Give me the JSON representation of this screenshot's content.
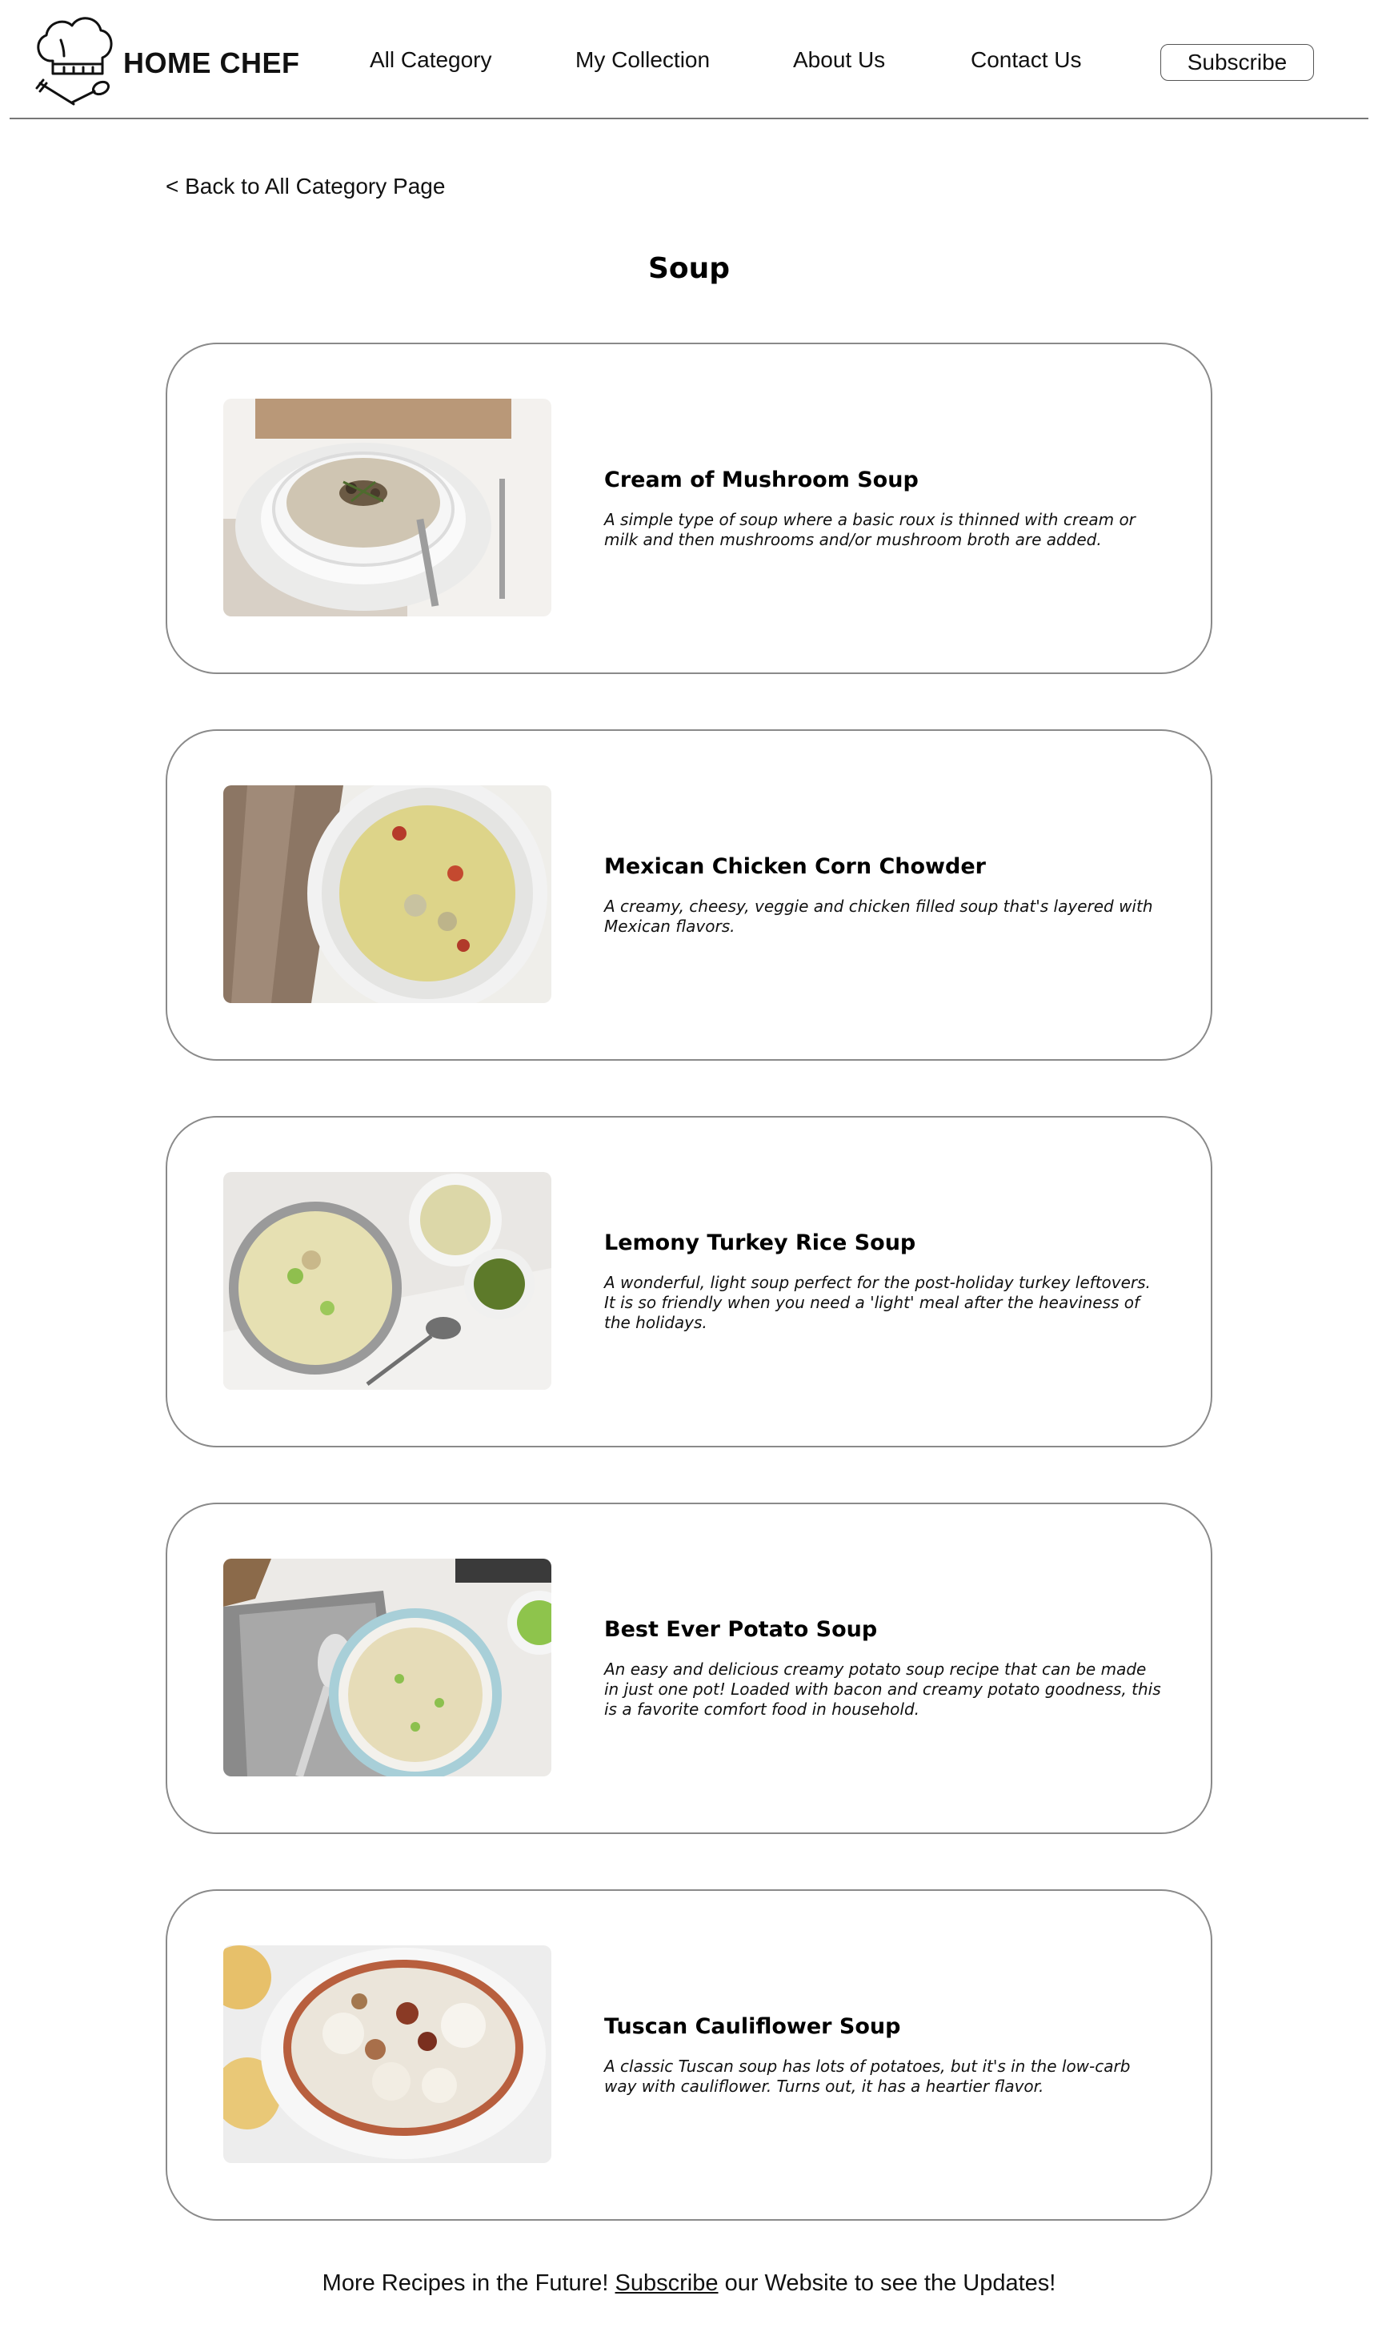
{
  "brand": {
    "name": "HOME CHEF",
    "logo_icon": "chef-hat-utensils-icon"
  },
  "nav": {
    "items": [
      {
        "label": "All Category"
      },
      {
        "label": "My Collection"
      },
      {
        "label": "About Us"
      },
      {
        "label": "Contact Us"
      }
    ],
    "subscribe_label": "Subscribe"
  },
  "back_link": "< Back to All Category Page",
  "page_title": "Soup",
  "recipes": [
    {
      "title": "Cream of Mushroom Soup",
      "description": "A simple type of soup where a basic roux is thinned with cream or milk and then mushrooms and/or mushroom broth are added.",
      "image_icon": "mushroom-soup-photo"
    },
    {
      "title": "Mexican Chicken Corn Chowder",
      "description": "A creamy, cheesy, veggie and chicken filled soup that's layered with Mexican flavors.",
      "image_icon": "corn-chowder-photo"
    },
    {
      "title": "Lemony Turkey Rice Soup",
      "description": "A wonderful, light soup perfect for the post-holiday turkey leftovers. It is so friendly when you need a 'light' meal after the heaviness of the holidays.",
      "image_icon": "turkey-rice-soup-photo"
    },
    {
      "title": "Best Ever Potato Soup",
      "description": "An easy and delicious creamy potato soup recipe that can be made in just one pot! Loaded with bacon and creamy potato goodness, this is a favorite comfort food in household.",
      "image_icon": "potato-soup-photo"
    },
    {
      "title": "Tuscan Cauliflower Soup",
      "description": "A classic Tuscan soup has lots of potatoes, but it's in the low-carb way with cauliflower. Turns out, it has a heartier flavor.",
      "image_icon": "cauliflower-soup-photo"
    }
  ],
  "footer": {
    "before": "More Recipes in the Future! ",
    "link": "Subscribe",
    "after": " our Website to see the Updates!"
  },
  "colors": {
    "card_border": "#8a8a8a",
    "header_rule": "#777777",
    "text": "#111111"
  }
}
